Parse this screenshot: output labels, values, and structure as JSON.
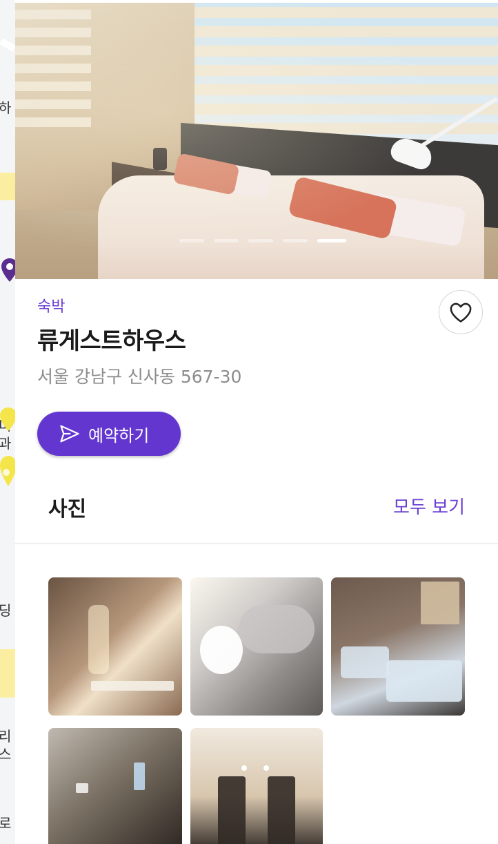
{
  "listing": {
    "category": "숙박",
    "name": "류게스트하우스",
    "address": "서울 강남구 신사동 567-30",
    "reserve_label": "예약하기"
  },
  "hero": {
    "slide_count": 5,
    "active_slide": 5
  },
  "photos": {
    "section_title": "사진",
    "see_all_label": "모두 보기",
    "thumbnail_count": 5
  },
  "map_labels": [
    "하",
    "미",
    "과",
    "딩",
    "리",
    "스",
    "로"
  ],
  "colors": {
    "accent": "#6a3fd1",
    "button": "#6336cf",
    "pin_purple": "#5b2d8f",
    "pin_yellow": "#f4e64a"
  },
  "icons": {
    "favorite": "heart-outline-icon",
    "reserve": "send-icon"
  }
}
